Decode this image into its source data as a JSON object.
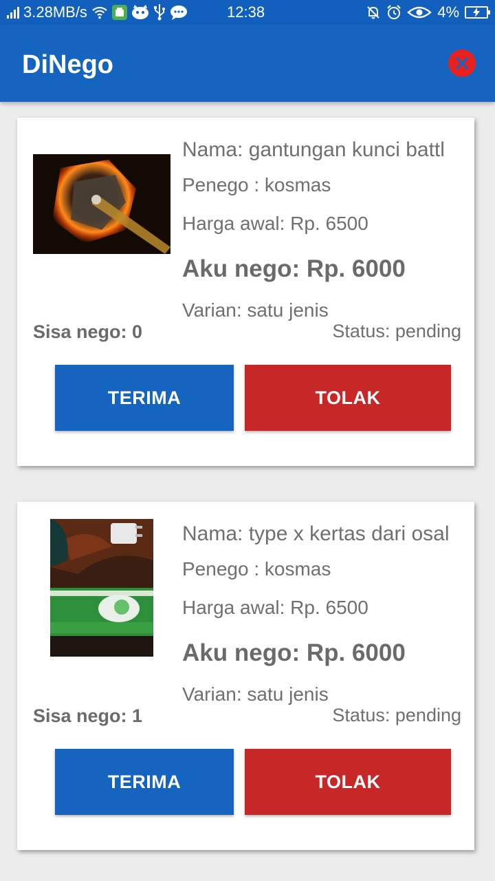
{
  "statusbar": {
    "speed": "3.28MB/s",
    "time": "12:38",
    "battery": "4%"
  },
  "app": {
    "title": "DiNego",
    "close_icon": "close-circle-icon",
    "colors": {
      "primary": "#1565c0",
      "accept": "#1565c0",
      "reject": "#c62828",
      "close": "#e8211f"
    }
  },
  "offers": [
    {
      "nama": "Nama: gantungan kunci battl",
      "penego": "Penego : kosmas",
      "harga_awal": "Harga awal: Rp. 6500",
      "nego": "Aku nego: Rp. 6000",
      "varian": "Varian: satu jenis",
      "sisa": "Sisa nego: 0",
      "status": "Status: pending",
      "accept_label": "TERIMA",
      "reject_label": "TOLAK"
    },
    {
      "nama": "Nama: type x kertas dari osal",
      "penego": "Penego : kosmas",
      "harga_awal": "Harga awal: Rp. 6500",
      "nego": "Aku nego: Rp. 6000",
      "varian": "Varian: satu jenis",
      "sisa": "Sisa nego: 1",
      "status": "Status: pending",
      "accept_label": "TERIMA",
      "reject_label": "TOLAK"
    }
  ]
}
